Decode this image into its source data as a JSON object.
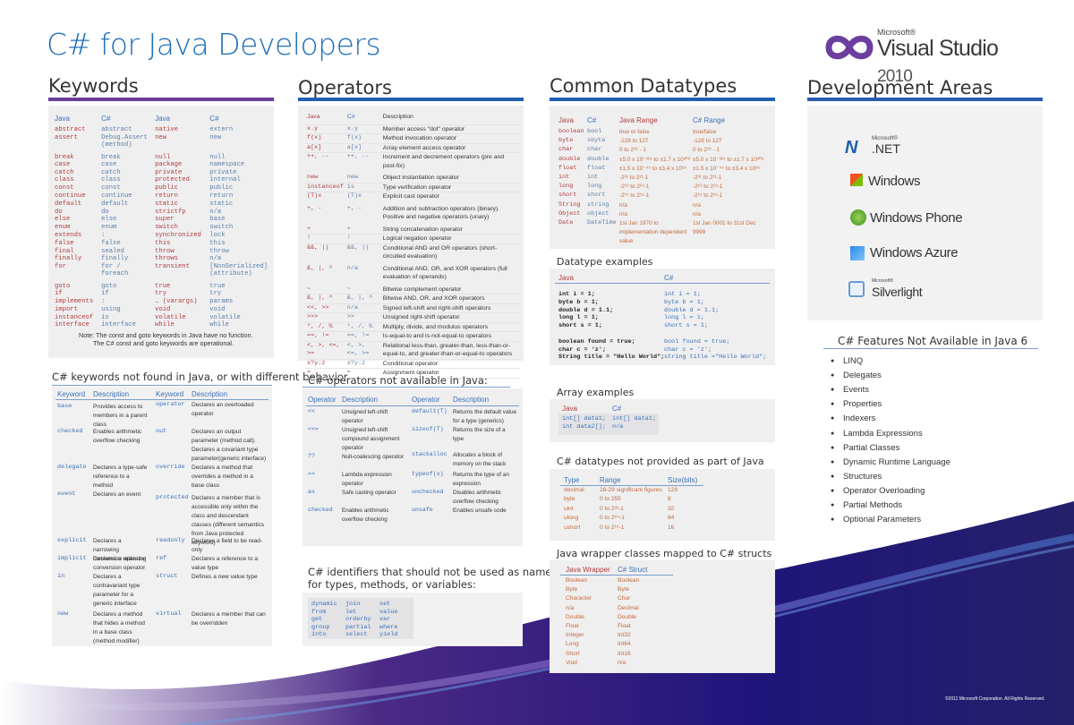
{
  "title": "C# for Java Developers",
  "logo": {
    "ms": "Microsoft®",
    "name": "Visual Studio",
    "year": "2010"
  },
  "headings": {
    "keywords": "Keywords",
    "operators": "Operators",
    "datatypes": "Common Datatypes",
    "areas": "Development Areas"
  },
  "keywords": {
    "headers": [
      "Java",
      "C#",
      "Java",
      "C#"
    ],
    "left": [
      [
        "abstract",
        "abstract"
      ],
      [
        "assert",
        "Debug.Assert (method)"
      ],
      [
        "break",
        "break"
      ],
      [
        "case",
        "case"
      ],
      [
        "catch",
        "catch"
      ],
      [
        "class",
        "class"
      ],
      [
        "const",
        "const"
      ],
      [
        "continue",
        "continue"
      ],
      [
        "default",
        "default"
      ],
      [
        "do",
        "do"
      ],
      [
        "else",
        "else"
      ],
      [
        "enum",
        "enum"
      ],
      [
        "extends",
        ":"
      ],
      [
        "false",
        "false"
      ],
      [
        "final",
        "sealed"
      ],
      [
        "finally",
        "finally"
      ],
      [
        "for",
        "for / foreach"
      ],
      [
        "goto",
        "goto"
      ],
      [
        "if",
        "if"
      ],
      [
        "implements",
        ":"
      ],
      [
        "import",
        "using"
      ],
      [
        "instanceof",
        "is"
      ],
      [
        "interface",
        "interface"
      ]
    ],
    "right": [
      [
        "native",
        "extern"
      ],
      [
        "new",
        "new"
      ],
      [
        "null",
        "null"
      ],
      [
        "package",
        "namespace"
      ],
      [
        "private",
        "private"
      ],
      [
        "protected",
        "internal"
      ],
      [
        "public",
        "public"
      ],
      [
        "return",
        "return"
      ],
      [
        "static",
        "static"
      ],
      [
        "strictfp",
        "n/a"
      ],
      [
        "super",
        "base"
      ],
      [
        "switch",
        "switch"
      ],
      [
        "synchronized",
        "lock"
      ],
      [
        "this",
        "this"
      ],
      [
        "throw",
        "throw"
      ],
      [
        "throws",
        "n/a"
      ],
      [
        "transient",
        "[NonSerialized] (attribute)"
      ],
      [
        "true",
        "true"
      ],
      [
        "try",
        "try"
      ],
      [
        "… (varargs)",
        "params"
      ],
      [
        "void",
        "void"
      ],
      [
        "volatile",
        "volatile"
      ],
      [
        "while",
        "while"
      ]
    ],
    "note1": "Note: The const and goto keywords in Java have no function.",
    "note2": "The C# const and goto keywords are operational."
  },
  "kwdiff": {
    "title": "C# keywords not found in Java, or with different behavior",
    "headers": [
      "Keyword",
      "Description",
      "Keyword",
      "Description"
    ],
    "left": [
      [
        "base",
        "Provides access to members in a parent class"
      ],
      [
        "checked",
        "Enables arithmetic overflow checking"
      ],
      [
        "delegate",
        "Declares a type-safe reference to a method"
      ],
      [
        "event",
        "Declares an event"
      ],
      [
        "explicit",
        "Declares a narrowing conversion operator"
      ],
      [
        "implicit",
        "Declares a widening conversion operator"
      ],
      [
        "in",
        "Declares a contravariant type parameter for a generic interface"
      ],
      [
        "new",
        "Declares a method that hides a method in a base class (method modifier)"
      ]
    ],
    "right": [
      [
        "operator",
        "Declares an overloaded operator"
      ],
      [
        "out",
        "Declares an output parameter (method call). Declares a covariant type parameter(generic interface)"
      ],
      [
        "override",
        "Declares a method that overrides a method in a base class"
      ],
      [
        "protected",
        "Declares a member that is accessible only within the class and descendant classes (different semantics from Java protected keyword)"
      ],
      [
        "readonly",
        "Declares a field to be read-only"
      ],
      [
        "ref",
        "Declares a reference to a value type"
      ],
      [
        "struct",
        "Defines a new value type"
      ],
      [
        "virtual",
        "Declares a member that can be overridden"
      ]
    ]
  },
  "operators": {
    "headers": [
      "Java",
      "C#",
      "Description"
    ],
    "rows": [
      [
        "x.y",
        "x.y",
        "Member access \"dot\" operator"
      ],
      [
        "f(x)",
        "f(x)",
        "Method invocation operator"
      ],
      [
        "a[x]",
        "a[x]",
        "Array element access operator"
      ],
      [
        "++, --",
        "++, --",
        "Increment and decrement operators (pre and post-fix)"
      ],
      [
        "new",
        "new",
        "Object instantiation operator"
      ],
      [
        "instanceof",
        "is",
        "Type verification operator"
      ],
      [
        "(T)x",
        "(T)x",
        "Explicit cast operator"
      ],
      [
        "+, -",
        "+, -",
        "Addition and subtraction operators (binary). Positive and negative operators (unary)"
      ],
      [
        "+",
        "+",
        "String concatenation operator"
      ],
      [
        "!",
        "!",
        "Logical negation operator"
      ],
      [
        "&&, ||",
        "&&, ||",
        "Conditional AND and OR operators (short-circuited evaluation)"
      ],
      [
        "&, |, ^",
        "n/a",
        "Conditional AND, OR, and XOR operators (full evaluation of operands)"
      ],
      [
        "~",
        "~",
        "Bitwise complement operator"
      ],
      [
        "&, |, ^",
        "&, |, ^",
        "Bitwise AND, OR, and XOR operators"
      ],
      [
        "<<, >>",
        "n/a",
        "Signed left-shift and right-shift operators"
      ],
      [
        ">>>",
        ">>",
        "Unsigned right-shift operator"
      ],
      [
        "*, /, %",
        "*, /, %",
        "Multiply, divide, and modulus operators"
      ],
      [
        "==, !=",
        "==, !=",
        "Is-equal-to and is-not-equal-to operators"
      ],
      [
        "<, >, <=, >=",
        "<, >, <=, >=",
        "Relational less-than, greater-than, less-than-or-equal-to, and greater-than-or-equal-to operators"
      ],
      [
        "x?y:z",
        "x?y:z",
        "Conditional operator"
      ],
      [
        "=",
        "=",
        "Assignment operator"
      ]
    ]
  },
  "opnot": {
    "title": "C# operators not available in Java:",
    "headers": [
      "Operator",
      "Description",
      "Operator",
      "Description"
    ],
    "left": [
      [
        "<<",
        "Unsigned left-shift operator"
      ],
      [
        "<<=",
        "Unsigned left-shift compound assignment operator"
      ],
      [
        "??",
        "Null-coalescing operator"
      ],
      [
        "=>",
        "Lambda expression operator"
      ],
      [
        "as",
        "Safe casting operator"
      ],
      [
        "checked",
        "Enables arithmetic overflow checking"
      ]
    ],
    "right": [
      [
        "default(T)",
        "Returns the default value for a type (generics)"
      ],
      [
        "sizeof(T)",
        "Returns the size of a type"
      ],
      [
        "stackalloc",
        "Allocates a block of memory on the stack"
      ],
      [
        "typeof(x)",
        "Returns the type of an expression"
      ],
      [
        "unchecked",
        "Disables arithmetic overflow checking"
      ],
      [
        "unsafe",
        "Enables unsafe code"
      ]
    ]
  },
  "idents": {
    "title1": "C# identifiers that should not be used as names",
    "title2": "for types, methods, or variables:",
    "rows": [
      [
        "dynamic",
        "join",
        "set"
      ],
      [
        "from",
        "let",
        "value"
      ],
      [
        "get",
        "orderby",
        "var"
      ],
      [
        "group",
        "partial",
        "where"
      ],
      [
        "into",
        "select",
        "yield"
      ]
    ]
  },
  "datatypes": {
    "headers": [
      "Java",
      "C#",
      "Java Range",
      "C# Range"
    ],
    "rows": [
      [
        "boolean",
        "bool",
        "true or false",
        "true/false"
      ],
      [
        "byte",
        "sbyte",
        "-128 to 127",
        "-128 to 127"
      ],
      [
        "char",
        "char",
        "0 to 2¹⁶ - 1",
        "0 to 2¹⁶ - 1"
      ],
      [
        "double",
        "double",
        "±5.0 x 10⁻³²⁴ to ±1.7 x 10³⁰⁸",
        "±5.0 x 10⁻³²⁴ to ±1.7 x 10³⁰⁸"
      ],
      [
        "float",
        "float",
        "±1.5 x 10⁻⁴⁵ to ±3.4 x 10³⁸",
        "±1.5 x 10⁻⁴⁵ to ±3.4 x 10³⁸"
      ],
      [
        "int",
        "int",
        "-2³¹ to 2³¹-1",
        "-2³¹ to 2³¹-1"
      ],
      [
        "long",
        "long",
        "-2⁶³ to 2⁶³-1",
        "-2⁶³ to 2⁶³-1"
      ],
      [
        "short",
        "short",
        "-2¹⁵ to 2¹⁵-1",
        "-2¹⁵ to 2¹⁵-1"
      ],
      [
        "String",
        "string",
        "n/a",
        "n/a"
      ],
      [
        "Object",
        "object",
        "n/a",
        "n/a"
      ],
      [
        "Date",
        "DateTime",
        "1st Jan 1970 to implementation dependent value",
        "1st Jan 0001 to 31st Dec 9999"
      ]
    ]
  },
  "dtex": {
    "title": "Datatype examples",
    "headers": [
      "Java",
      "C#"
    ],
    "java": [
      "int i = 1;",
      "byte b = 1;",
      "double d = 1.1;",
      "long l = 1;",
      "short s = 1;",
      "",
      "boolean found = true;",
      "char c = 'z';",
      "String title = \"Hello World\";"
    ],
    "cs": [
      "int i = 1;",
      "byte b = 1;",
      "double d = 1.1;",
      "long l = 1;",
      "short s = 1;",
      "",
      "bool found = true;",
      "char c = 'z';",
      "string title =\"Hello World\";"
    ]
  },
  "arrex": {
    "title": "Array examples",
    "headers": [
      "Java",
      "C#"
    ],
    "java": [
      "int[] data1;",
      "int data2[];"
    ],
    "cs": [
      "int[] data1;",
      "n/a"
    ]
  },
  "dtnot": {
    "title": "C# datatypes not provided as part of Java",
    "headers": [
      "Type",
      "Range",
      "Size(bits)"
    ],
    "rows": [
      [
        "decimal",
        "28-29 significant figures",
        "128"
      ],
      [
        "byte",
        "0 to 255",
        "8"
      ],
      [
        "uint",
        "0 to 2³²-1",
        "32"
      ],
      [
        "ulong",
        "0 to 2⁶⁴-1",
        "64"
      ],
      [
        "ushort",
        "0 to 2¹⁶-1",
        "16"
      ]
    ]
  },
  "wrap": {
    "title": "Java wrapper classes mapped to C# structs",
    "headers": [
      "Java Wrapper",
      "C# Struct"
    ],
    "rows": [
      [
        "Boolean",
        "Boolean"
      ],
      [
        "Byte",
        "Byte"
      ],
      [
        "Character",
        "Char"
      ],
      [
        "n/a",
        "Decimal"
      ],
      [
        "Double",
        "Double"
      ],
      [
        "Float",
        "Float"
      ],
      [
        "Integer",
        "Int32"
      ],
      [
        "Long",
        "Int64"
      ],
      [
        "Short",
        "Int16"
      ],
      [
        "Void",
        "n/a"
      ]
    ]
  },
  "platforms": {
    "ms": "Microsoft®",
    "net": ".NET",
    "windows": "Windows",
    "phone": "Windows Phone",
    "azure": "Windows Azure",
    "silver": "Silverlight"
  },
  "features": {
    "title": "C# Features Not Available in Java 6",
    "items": [
      "LINQ",
      "Delegates",
      "Events",
      "Properties",
      "Indexers",
      "Lambda Expressions",
      "Partial Classes",
      "Dynamic Runtime Language",
      "Structures",
      "Operator Overloading",
      "Partial Methods",
      "Optional Parameters"
    ]
  },
  "copyright": "©2011 Microsoft Corporation. All Rights Reserved.",
  "colors": {
    "purple": "#6a3d9a",
    "blue": "#1f5fb0",
    "accent": "#1f6fb8"
  }
}
